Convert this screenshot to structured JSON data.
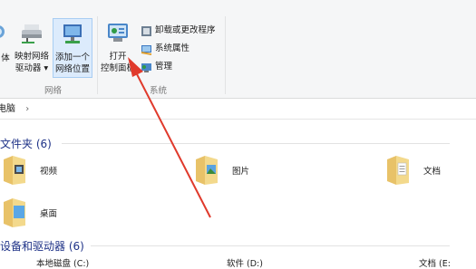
{
  "ribbon": {
    "buttons": [
      {
        "label1": "体",
        "label2": ""
      },
      {
        "label1": "映射网络",
        "label2": "驱动器 ▾"
      },
      {
        "label1": "添加一个",
        "label2": "网络位置"
      },
      {
        "label1": "打开",
        "label2": "控制面板"
      }
    ],
    "small_commands": [
      "卸载或更改程序",
      "系统属性",
      "管理"
    ],
    "groups": [
      "网络",
      "系统"
    ]
  },
  "address": {
    "crumb": "电脑",
    "sep": "›"
  },
  "sections": {
    "folders": {
      "title": "文件夹 (6)"
    },
    "devices": {
      "title": "设备和驱动器 (6)"
    }
  },
  "folders": [
    "视频",
    "图片",
    "文档",
    "桌面"
  ],
  "drives": [
    "本地磁盘 (C:)",
    "软件 (D:)",
    "文档 (E:"
  ],
  "colors": {
    "accent": "#1e3287",
    "arrow": "#e03a2c",
    "selected": "#dcebfc"
  }
}
